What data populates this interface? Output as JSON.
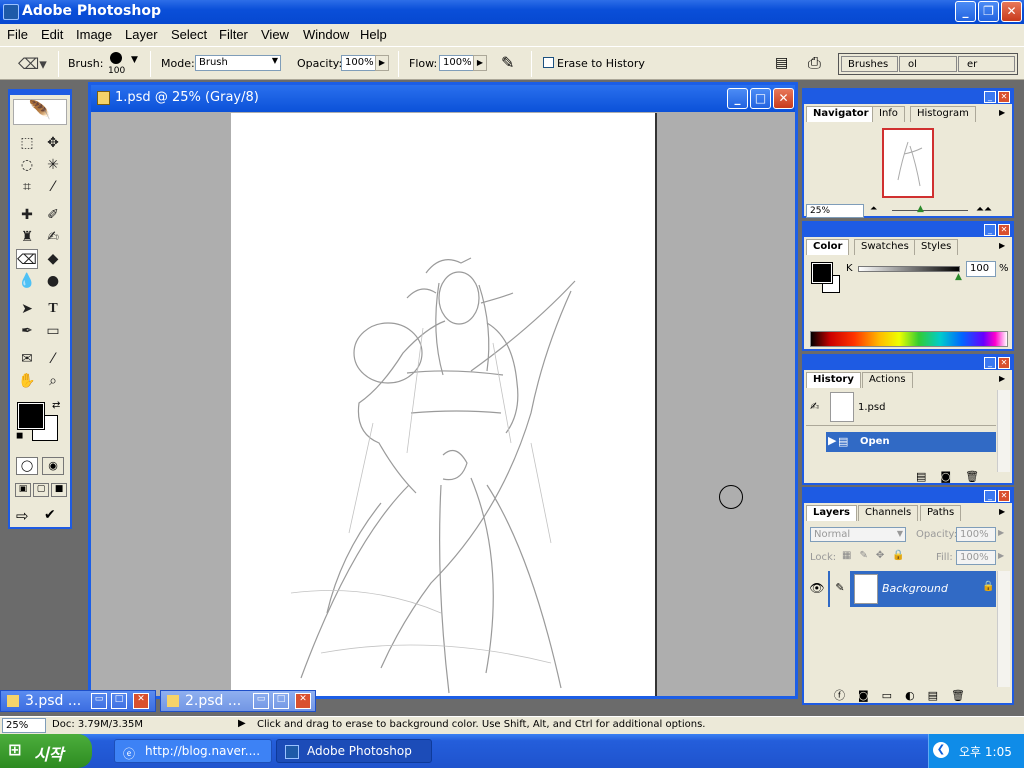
{
  "app": {
    "title": "Adobe Photoshop"
  },
  "menu": [
    "File",
    "Edit",
    "Image",
    "Layer",
    "Select",
    "Filter",
    "View",
    "Window",
    "Help"
  ],
  "options": {
    "brush_label": "Brush:",
    "brush_size": "100",
    "mode_label": "Mode:",
    "mode_value": "Brush",
    "opacity_label": "Opacity:",
    "opacity_value": "100%",
    "flow_label": "Flow:",
    "flow_value": "100%",
    "erase_history_label": "Erase to History",
    "palette_well_tabs": [
      "Brushes",
      "ol Presets",
      "er Comps"
    ]
  },
  "document": {
    "title": "1.psd @ 25% (Gray/8)"
  },
  "minimized_docs": [
    "3.psd ...",
    "2.psd ..."
  ],
  "navigator": {
    "tabs": [
      "Navigator",
      "Info",
      "Histogram"
    ],
    "zoom": "25%"
  },
  "color": {
    "tabs": [
      "Color",
      "Swatches",
      "Styles"
    ],
    "channel": "K",
    "value": "100",
    "unit": "%"
  },
  "history": {
    "tabs": [
      "History",
      "Actions"
    ],
    "snapshot": "1.psd",
    "state": "Open"
  },
  "layers": {
    "tabs": [
      "Layers",
      "Channels",
      "Paths"
    ],
    "blend_mode": "Normal",
    "opacity_label": "Opacity:",
    "opacity_value": "100%",
    "lock_label": "Lock:",
    "fill_label": "Fill:",
    "fill_value": "100%",
    "layer_name": "Background"
  },
  "status": {
    "zoom": "25%",
    "doc_info": "Doc: 3.79M/3.35M",
    "hint": "Click and drag to erase to background color.  Use Shift, Alt, and Ctrl for additional options."
  },
  "taskbar": {
    "start_label": "시작",
    "items": [
      "http://blog.naver....",
      "Adobe Photoshop"
    ],
    "clock": "오후 1:05"
  },
  "colors": {
    "xp_blue": "#1e5be3",
    "panel_bg": "#ece9d8",
    "selection": "#316ac5"
  }
}
